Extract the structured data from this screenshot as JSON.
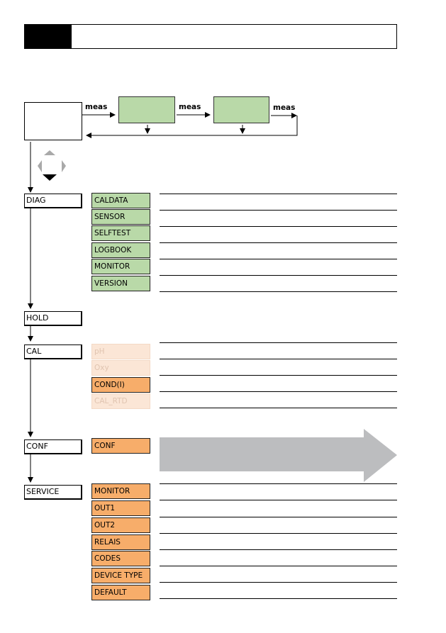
{
  "header": {
    "number": "",
    "title": ""
  },
  "flow": {
    "arrow_label": "meas",
    "labels": [
      "meas",
      "meas",
      "meas"
    ]
  },
  "menus": [
    {
      "label": "DIAG",
      "items": [
        {
          "label": "CALDATA",
          "state": "green"
        },
        {
          "label": "SENSOR",
          "state": "green"
        },
        {
          "label": "SELFTEST",
          "state": "green"
        },
        {
          "label": "LOGBOOK",
          "state": "green"
        },
        {
          "label": "MONITOR",
          "state": "green"
        },
        {
          "label": "VERSION",
          "state": "green"
        }
      ]
    },
    {
      "label": "HOLD",
      "items": []
    },
    {
      "label": "CAL",
      "items": [
        {
          "label": "pH",
          "state": "disabled"
        },
        {
          "label": "Oxy",
          "state": "disabled"
        },
        {
          "label": "COND(I)",
          "state": "active"
        },
        {
          "label": "CAL_RTD",
          "state": "disabled"
        }
      ]
    },
    {
      "label": "CONF",
      "items": [
        {
          "label": "CONF",
          "state": "active"
        }
      ]
    },
    {
      "label": "SERVICE",
      "items": [
        {
          "label": "MONITOR",
          "state": "active"
        },
        {
          "label": "OUT1",
          "state": "active"
        },
        {
          "label": "OUT2",
          "state": "active"
        },
        {
          "label": "RELAIS",
          "state": "active"
        },
        {
          "label": "CODES",
          "state": "active"
        },
        {
          "label": "DEVICE TYPE",
          "state": "active"
        },
        {
          "label": "DEFAULT",
          "state": "active"
        }
      ]
    }
  ],
  "colors": {
    "green": "#b9d9a8",
    "orange": "#f7ad6a",
    "disabled": "#fbe6d6",
    "arrow_gray": "#bcbdbf"
  }
}
